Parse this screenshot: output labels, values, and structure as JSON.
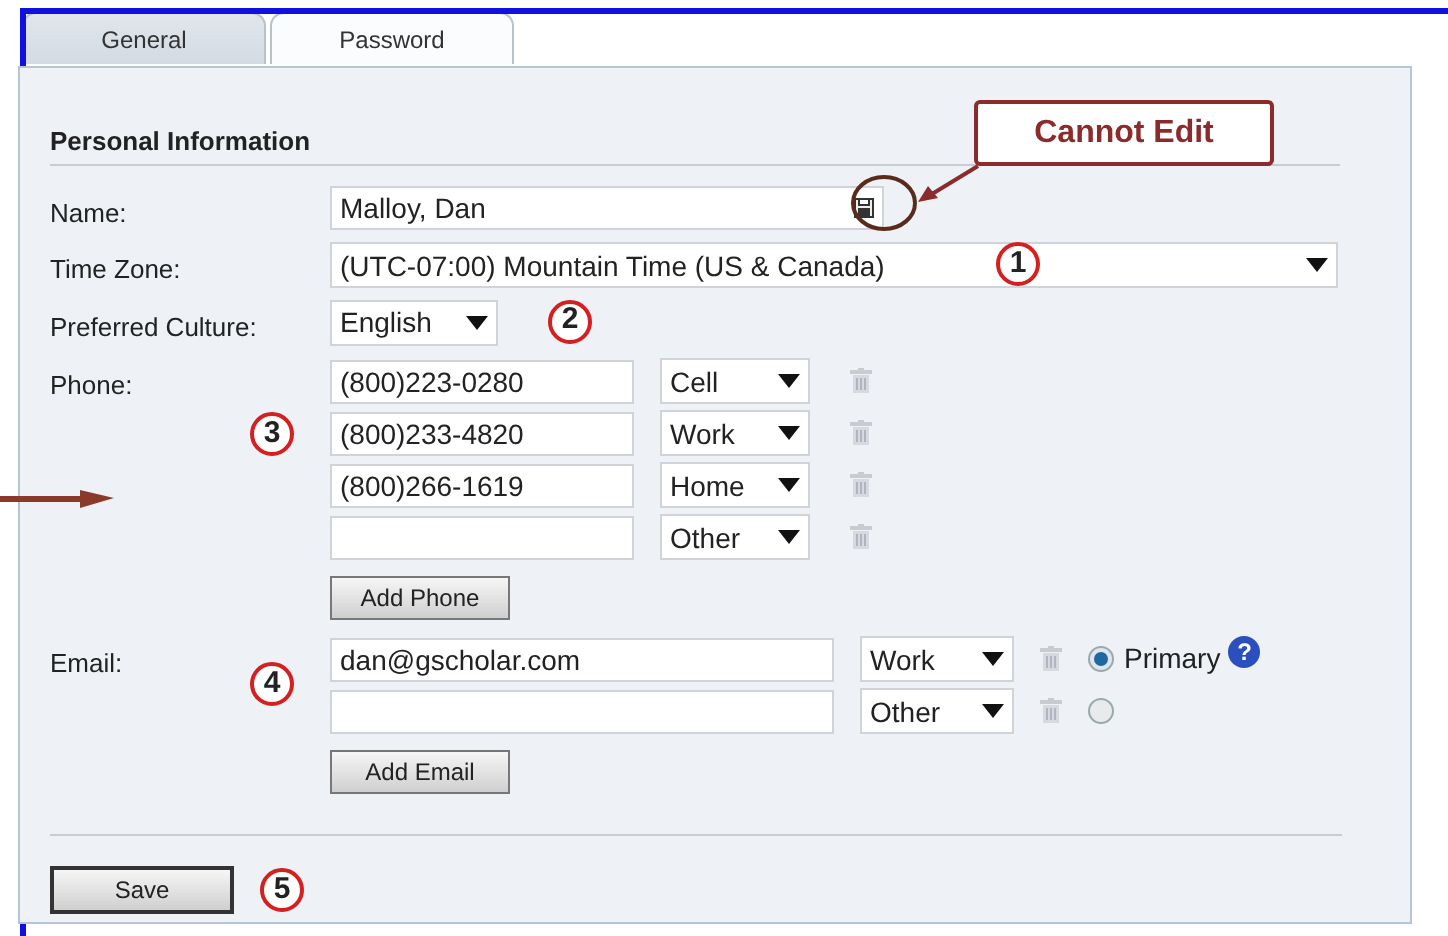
{
  "tabs": [
    {
      "label": "General",
      "selected": true
    },
    {
      "label": "Password",
      "selected": false
    }
  ],
  "section_title": "Personal Information",
  "name": {
    "label": "Name:",
    "value": "Malloy, Dan"
  },
  "time_zone": {
    "label": "Time Zone:",
    "value": "(UTC-07:00) Mountain Time (US & Canada)",
    "marker": "1"
  },
  "culture": {
    "label": "Preferred Culture:",
    "value": "English",
    "marker": "2"
  },
  "phone": {
    "label": "Phone:",
    "marker": "3",
    "add_button": "Add Phone",
    "rows": [
      {
        "number": "(800)223-0280",
        "type": "Cell"
      },
      {
        "number": "(800)233-4820",
        "type": "Work"
      },
      {
        "number": "(800)266-1619",
        "type": "Home"
      },
      {
        "type": "Other"
      }
    ]
  },
  "email": {
    "label": "Email:",
    "marker": "4",
    "add_button": "Add Email",
    "primary_label": "Primary",
    "help": "?",
    "rows": [
      {
        "address": "dan@gscholar.com",
        "type": "Work",
        "selected": true
      },
      {
        "type": "Other",
        "selected": false
      }
    ]
  },
  "save": {
    "label": "Save",
    "marker": "5"
  },
  "callout": "Cannot Edit"
}
